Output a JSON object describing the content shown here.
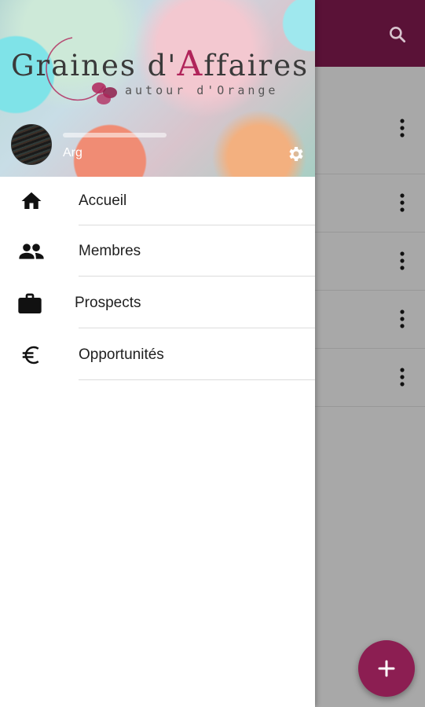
{
  "header": {
    "logo_prefix": "Graines d'",
    "logo_big_letter": "A",
    "logo_suffix": "ffaires",
    "logo_subtitle": "autour d'Orange",
    "user_name": "Arg"
  },
  "menu": {
    "items": [
      {
        "label": "Accueil",
        "icon": "home-icon"
      },
      {
        "label": "Membres",
        "icon": "people-icon"
      },
      {
        "label": "Prospects",
        "icon": "briefcase-icon"
      },
      {
        "label": "Opportunités",
        "icon": "euro-icon"
      }
    ]
  },
  "colors": {
    "toolbar": "#5a1237",
    "accent": "#8c1e52",
    "logo_accent": "#b0245a"
  }
}
